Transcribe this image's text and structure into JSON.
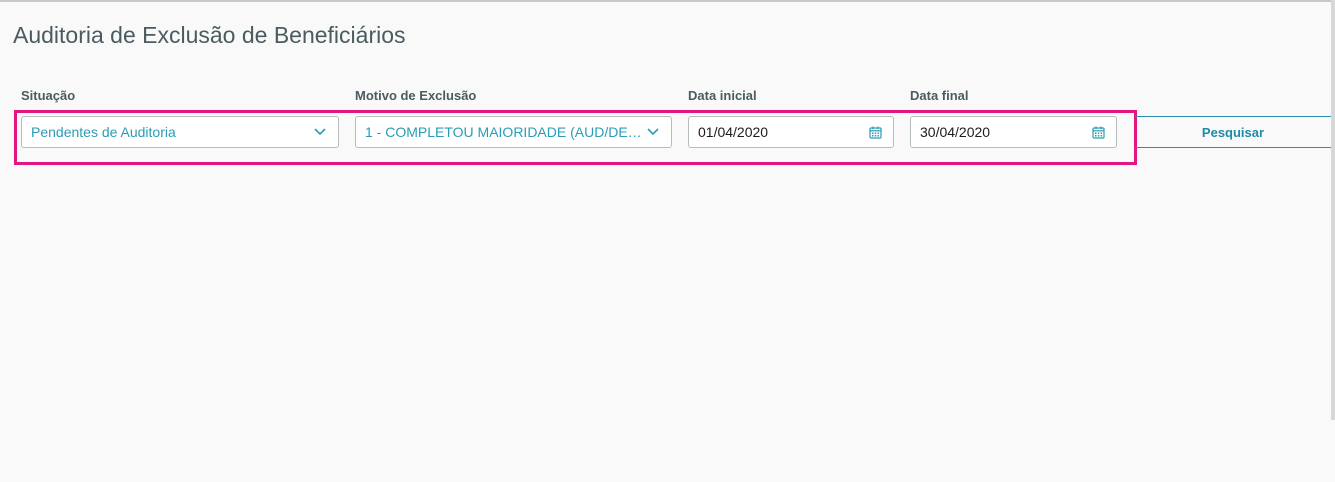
{
  "page": {
    "title": "Auditoria de Exclusão de Beneficiários"
  },
  "filters": {
    "situacao": {
      "label": "Situação",
      "value": "Pendentes de Auditoria",
      "icon": "chevron-down-icon"
    },
    "motivo": {
      "label": "Motivo de Exclusão",
      "value": "1 - COMPLETOU MAIORIDADE (AUD/DE…",
      "icon": "chevron-down-icon"
    },
    "data_inicial": {
      "label": "Data inicial",
      "value": "01/04/2020",
      "icon": "calendar-icon"
    },
    "data_final": {
      "label": "Data final",
      "value": "30/04/2020",
      "icon": "calendar-icon"
    },
    "search_button": {
      "label": "Pesquisar"
    }
  },
  "colors": {
    "accent": "#1f8ba7",
    "highlight": "#e5157f",
    "select_text": "#2a9db5",
    "label_text": "#4a5c60"
  }
}
